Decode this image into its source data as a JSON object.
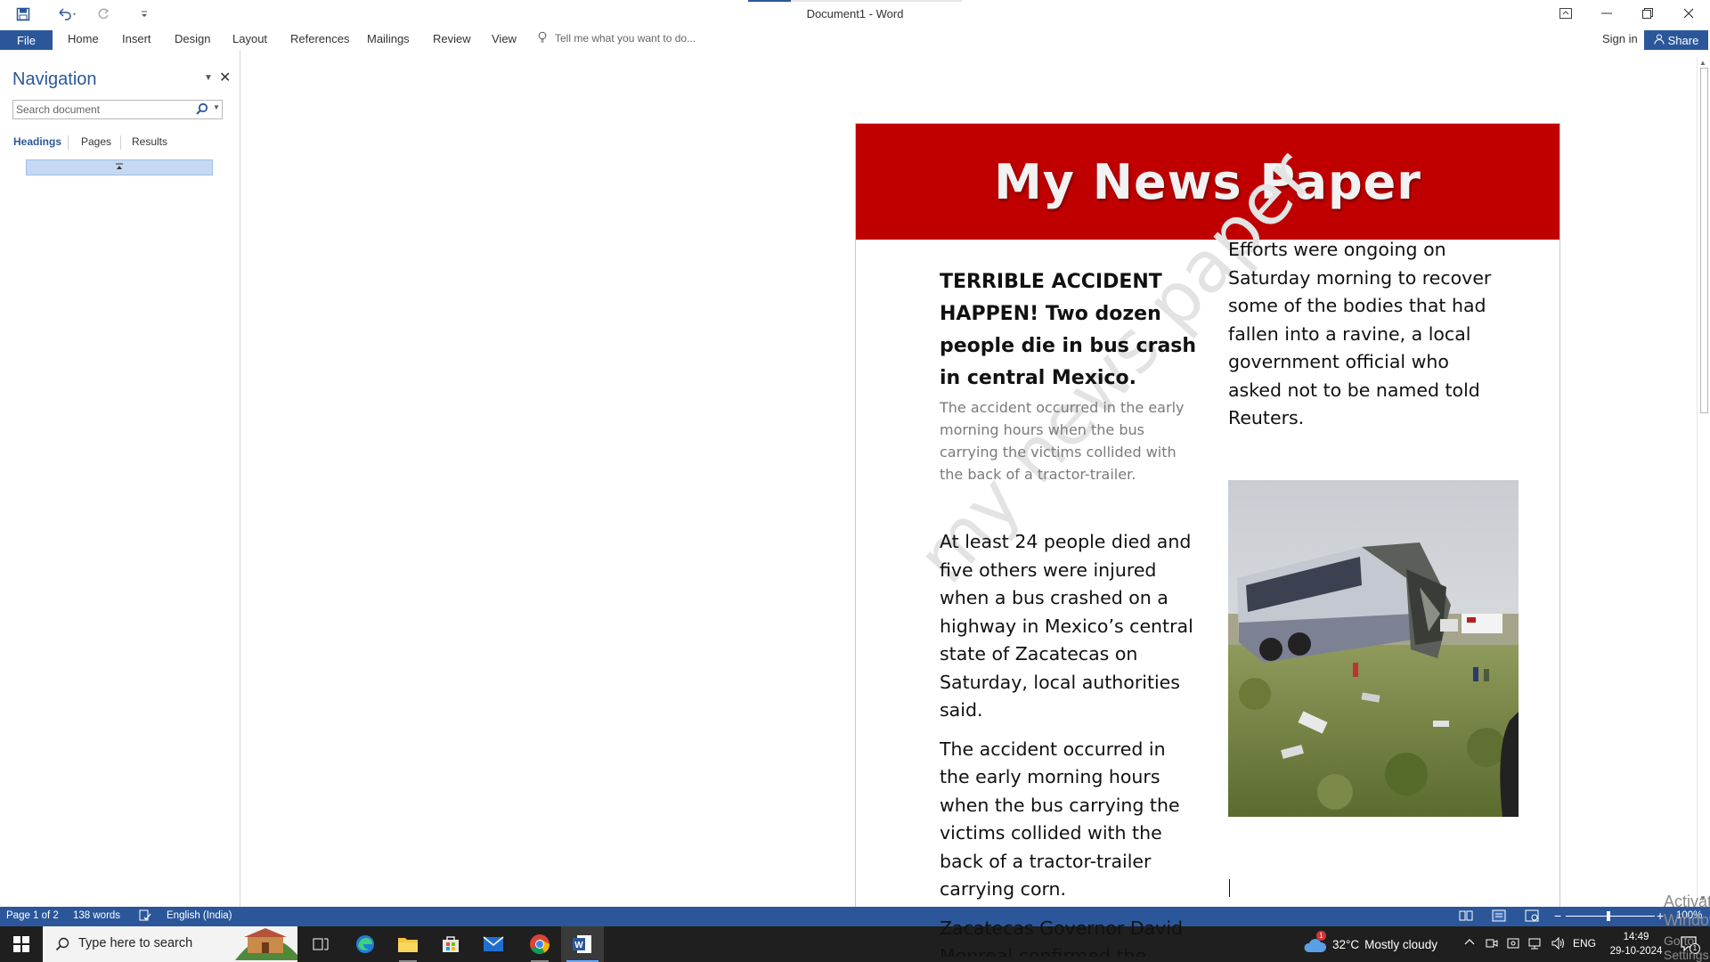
{
  "window": {
    "title": "Document1 - Word",
    "controls": [
      "ribbon-display-options",
      "minimize",
      "restore",
      "close"
    ]
  },
  "ribbon": {
    "file_label": "File",
    "tabs": [
      "Home",
      "Insert",
      "Design",
      "Layout",
      "References",
      "Mailings",
      "Review",
      "View"
    ],
    "tell_me": "Tell me what you want to do...",
    "sign_in": "Sign in",
    "share": "Share"
  },
  "navigation": {
    "title": "Navigation",
    "search_placeholder": "Search document",
    "tabs": [
      "Headings",
      "Pages",
      "Results"
    ],
    "active_tab": "Headings"
  },
  "document": {
    "masthead": "My News Paper",
    "watermark": "my news paper",
    "headline": "TERRIBLE ACCIDENT HAPPEN! Two dozen people die in bus crash in central Mexico.",
    "subheading": "The accident occurred in the early morning hours when the bus carrying the victims collided with the back of a tractor-trailer.",
    "paragraph1": "At least 24 people died and five others were injured when a bus crashed on a highway in Mexico’s central state of Zacatecas on Saturday, local authorities said.",
    "paragraph2": "The accident occurred in the early morning hours when the bus carrying the victims collided with the back of a tractor-trailer carrying corn.",
    "paragraph3_before": "Zacatecas Governor David ",
    "paragraph3_misspelled": "Monreal",
    "paragraph3_after": " confirmed the",
    "right_paragraph": "Efforts were ongoing on Saturday morning to recover some of the bodies that had fallen into a ravine, a local government official who asked not to be named told Reuters."
  },
  "activation": {
    "line1": "Activate Windows",
    "line2": "Go to Settings to activate Windows."
  },
  "status": {
    "page": "Page 1 of 2",
    "words": "138 words",
    "language": "English (India)",
    "zoom": "100%",
    "zoom_level": 1.0
  },
  "taskbar": {
    "search_placeholder": "Type here to search",
    "apps": [
      "task-view",
      "edge",
      "file-explorer",
      "microsoft-store",
      "mail",
      "chrome",
      "word"
    ],
    "weather_temp": "32°C",
    "weather_desc": "Mostly cloudy",
    "weather_badge": "1",
    "language": "ENG",
    "time": "14:49",
    "date": "29-10-2024",
    "notification_count": "1"
  },
  "colors": {
    "word_blue": "#2b579a",
    "masthead_red": "#c00000",
    "taskbar": "#1f1f1f"
  }
}
